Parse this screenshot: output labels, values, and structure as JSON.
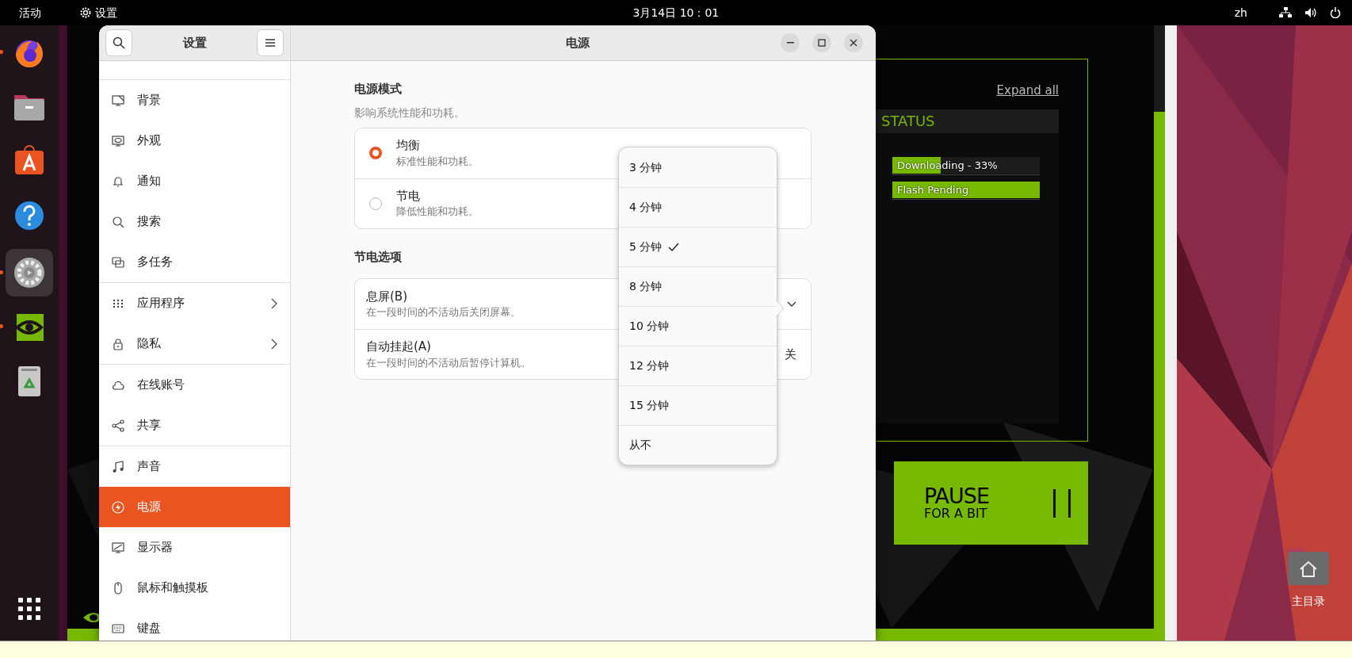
{
  "top_bar": {
    "activities": "活动",
    "app_menu": "设置",
    "clock": "3月14日 10：01",
    "input_method": "zh"
  },
  "dock": {
    "items": [
      {
        "kind": "firefox",
        "running": true,
        "selected": false
      },
      {
        "kind": "files",
        "running": false,
        "selected": false
      },
      {
        "kind": "app-center",
        "running": false,
        "selected": false
      },
      {
        "kind": "help",
        "running": false,
        "selected": false
      },
      {
        "kind": "settings",
        "running": true,
        "selected": true
      },
      {
        "kind": "nvidia",
        "running": true,
        "selected": false
      },
      {
        "kind": "trash",
        "running": false,
        "selected": false
      }
    ]
  },
  "background_app": {
    "expand_link": "Expand all",
    "status_title": "STATUS",
    "progress": [
      {
        "label": "Downloading - 33%",
        "level": 0.33
      },
      {
        "label": "Flash Pending",
        "level": 1
      }
    ],
    "pause_button": {
      "title": "PAUSE",
      "subtitle": "FOR A BIT"
    }
  },
  "desktop_icons": [
    {
      "label": "主目录"
    }
  ],
  "settings_window": {
    "sidebar_title": "设置",
    "page_title": "电源",
    "sidebar_groups": [
      {
        "items": [
          {
            "label": "背景",
            "kind": "background",
            "submenu": false,
            "selected": false
          },
          {
            "label": "外观",
            "kind": "appearance",
            "submenu": false,
            "selected": false
          },
          {
            "label": "通知",
            "kind": "notifications",
            "submenu": false,
            "selected": false
          },
          {
            "label": "搜索",
            "kind": "search",
            "submenu": false,
            "selected": false
          },
          {
            "label": "多任务",
            "kind": "multitasking",
            "submenu": false,
            "selected": false
          }
        ]
      },
      {
        "items": [
          {
            "label": "应用程序",
            "kind": "apps",
            "submenu": true,
            "selected": false
          },
          {
            "label": "隐私",
            "kind": "privacy",
            "submenu": true,
            "selected": false
          }
        ]
      },
      {
        "items": [
          {
            "label": "在线账号",
            "kind": "online-accounts",
            "submenu": false,
            "selected": false
          },
          {
            "label": "共享",
            "kind": "sharing",
            "submenu": false,
            "selected": false
          }
        ]
      },
      {
        "items": [
          {
            "label": "声音",
            "kind": "sound",
            "submenu": false,
            "selected": false
          },
          {
            "label": "电源",
            "kind": "power",
            "submenu": false,
            "selected": true
          },
          {
            "label": "显示器",
            "kind": "displays",
            "submenu": false,
            "selected": false
          },
          {
            "label": "鼠标和触摸板",
            "kind": "mouse",
            "submenu": false,
            "selected": false
          },
          {
            "label": "键盘",
            "kind": "keyboard",
            "submenu": false,
            "selected": false
          }
        ]
      }
    ],
    "power_mode": {
      "title": "电源模式",
      "subtitle": "影响系统性能和功耗。",
      "options": [
        {
          "label": "均衡",
          "description": "标准性能和功耗。",
          "selected": true
        },
        {
          "label": "节电",
          "description": "降低性能和功耗。",
          "selected": false
        }
      ]
    },
    "power_saving": {
      "title": "节电选项",
      "rows": [
        {
          "label": "息屏(B)",
          "description": "在一段时间的不活动后关闭屏幕。",
          "kind": "dropdown"
        },
        {
          "label": "自动挂起(A)",
          "description": "在一段时间的不活动后暂停计算机。",
          "kind": "value",
          "value": "关"
        }
      ]
    },
    "dropdown_menu": {
      "options": [
        {
          "label": "3 分钟",
          "selected": false
        },
        {
          "label": "4 分钟",
          "selected": false
        },
        {
          "label": "5 分钟",
          "selected": true
        },
        {
          "label": "8 分钟",
          "selected": false
        },
        {
          "label": "10 分钟",
          "selected": false
        },
        {
          "label": "12 分钟",
          "selected": false
        },
        {
          "label": "15 分钟",
          "selected": false
        },
        {
          "label": "从不",
          "selected": false
        }
      ]
    }
  }
}
